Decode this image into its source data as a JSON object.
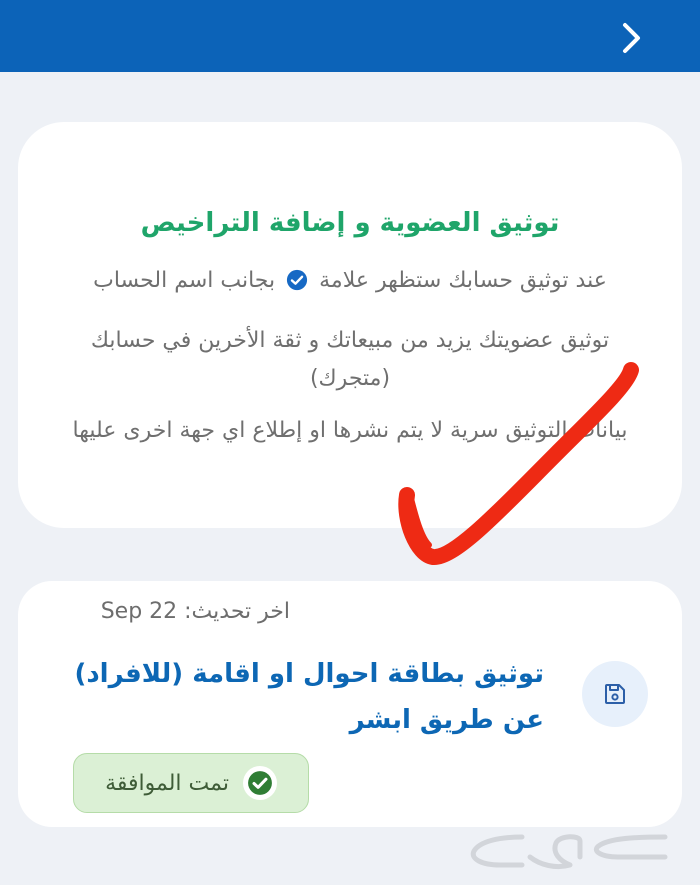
{
  "header": {
    "back_icon": "chevron-right-icon",
    "bar_color": "#0c63b8"
  },
  "info_card": {
    "title": "توثيق العضوية و إضافة التراخيص",
    "line1_before": "عند توثيق حسابك ستظهر علامة",
    "line1_after": "بجانب اسم الحساب",
    "line2": "توثيق عضويتك يزيد من مبيعاتك و ثقة الأخرين في حسابك (متجرك)",
    "line3": "بيانات التوثيق سرية لا يتم نشرها او إطلاع اي جهة اخرى عليها",
    "verified_icon": "verified-check-icon",
    "title_color": "#1fa56a"
  },
  "verification_card": {
    "last_updated": "اخر تحديث: Sep 22",
    "title": "توثيق بطاقة احوال او اقامة (للافراد) عن طريق ابشر",
    "save_icon": "floppy-disk-icon",
    "status_label": "تمت الموافقة",
    "status_icon": "check-circle-icon",
    "title_color": "#0d67b4"
  },
  "overlay": {
    "annotation": "red-hand-drawn-checkmark",
    "color": "#ee2a14"
  },
  "watermark": {
    "text": "حراج"
  }
}
